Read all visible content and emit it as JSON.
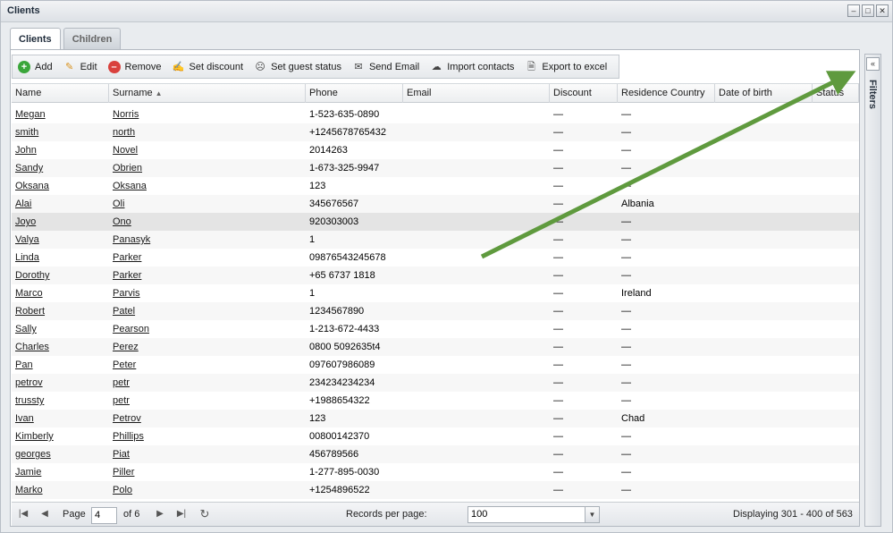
{
  "window": {
    "title": "Clients"
  },
  "tabs": [
    {
      "label": "Clients",
      "active": true
    },
    {
      "label": "Children",
      "active": false
    }
  ],
  "toolbar": {
    "add": "Add",
    "edit": "Edit",
    "remove": "Remove",
    "set_discount": "Set discount",
    "set_guest_status": "Set guest status",
    "send_email": "Send Email",
    "import_contacts": "Import contacts",
    "export_excel": "Export to excel"
  },
  "columns": {
    "name": "Name",
    "surname": "Surname",
    "phone": "Phone",
    "email": "Email",
    "discount": "Discount",
    "country": "Residence Country",
    "dob": "Date of birth",
    "status": "Status"
  },
  "rows": [
    {
      "name": "Megan",
      "surname": "Norris",
      "phone": "1-523-635-0890",
      "email": "",
      "discount": "—",
      "country": "—",
      "dob": "",
      "status": ""
    },
    {
      "name": "smith",
      "surname": "north",
      "phone": "+1245678765432",
      "email": "",
      "discount": "—",
      "country": "—",
      "dob": "",
      "status": ""
    },
    {
      "name": "John",
      "surname": "Novel",
      "phone": "2014263",
      "email": "",
      "discount": "—",
      "country": "—",
      "dob": "",
      "status": ""
    },
    {
      "name": "Sandy",
      "surname": "Obrien",
      "phone": "1-673-325-9947",
      "email": "",
      "discount": "—",
      "country": "—",
      "dob": "",
      "status": ""
    },
    {
      "name": "Oksana",
      "surname": "Oksana",
      "phone": "123",
      "email": "",
      "discount": "—",
      "country": "—",
      "dob": "",
      "status": ""
    },
    {
      "name": "Alai",
      "surname": "Oli",
      "phone": "345676567",
      "email": "",
      "discount": "—",
      "country": "Albania",
      "dob": "",
      "status": ""
    },
    {
      "name": "Joyo",
      "surname": "Ono",
      "phone": "920303003",
      "email": "",
      "discount": "—",
      "country": "—",
      "dob": "",
      "status": "",
      "selected": true
    },
    {
      "name": "Valya",
      "surname": "Panasyk",
      "phone": "1",
      "email": "",
      "discount": "—",
      "country": "—",
      "dob": "",
      "status": ""
    },
    {
      "name": "Linda",
      "surname": "Parker",
      "phone": "09876543245678",
      "email": "",
      "discount": "—",
      "country": "—",
      "dob": "",
      "status": ""
    },
    {
      "name": "Dorothy",
      "surname": "Parker",
      "phone": "+65 6737 1818",
      "email": "",
      "discount": "—",
      "country": "—",
      "dob": "",
      "status": ""
    },
    {
      "name": "Marco",
      "surname": "Parvis",
      "phone": "1",
      "email": "",
      "discount": "—",
      "country": "Ireland",
      "dob": "",
      "status": ""
    },
    {
      "name": "Robert",
      "surname": "Patel",
      "phone": "1234567890",
      "email": "",
      "discount": "—",
      "country": "—",
      "dob": "",
      "status": ""
    },
    {
      "name": "Sally",
      "surname": "Pearson",
      "phone": "1-213-672-4433",
      "email": "",
      "discount": "—",
      "country": "—",
      "dob": "",
      "status": ""
    },
    {
      "name": "Charles",
      "surname": "Perez",
      "phone": "0800 5092635t4",
      "email": "",
      "discount": "—",
      "country": "—",
      "dob": "",
      "status": ""
    },
    {
      "name": "Pan",
      "surname": "Peter",
      "phone": "097607986089",
      "email": "",
      "discount": "—",
      "country": "—",
      "dob": "",
      "status": ""
    },
    {
      "name": "petrov",
      "surname": "petr",
      "phone": "234234234234",
      "email": "",
      "discount": "—",
      "country": "—",
      "dob": "",
      "status": ""
    },
    {
      "name": "trussty",
      "surname": "petr",
      "phone": "+1988654322",
      "email": "",
      "discount": "—",
      "country": "—",
      "dob": "",
      "status": ""
    },
    {
      "name": "Ivan",
      "surname": "Petrov",
      "phone": "123",
      "email": "",
      "discount": "—",
      "country": "Chad",
      "dob": "",
      "status": ""
    },
    {
      "name": "Kimberly",
      "surname": "Phillips",
      "phone": "00800142370",
      "email": "",
      "discount": "—",
      "country": "—",
      "dob": "",
      "status": ""
    },
    {
      "name": "georges",
      "surname": "Piat",
      "phone": "456789566",
      "email": "",
      "discount": "—",
      "country": "—",
      "dob": "",
      "status": ""
    },
    {
      "name": "Jamie",
      "surname": "Piller",
      "phone": "1-277-895-0030",
      "email": "",
      "discount": "—",
      "country": "—",
      "dob": "",
      "status": ""
    },
    {
      "name": "Marko",
      "surname": "Polo",
      "phone": "+1254896522",
      "email": "",
      "discount": "—",
      "country": "—",
      "dob": "",
      "status": ""
    }
  ],
  "pager": {
    "page_label": "Page",
    "page_value": "4",
    "of_label": "of 6",
    "records_label": "Records per page:",
    "records_value": "100",
    "display_text": "Displaying 301 - 400 of 563"
  },
  "filters": {
    "label": "Filters"
  },
  "colors": {
    "arrow": "#5f9a3e"
  }
}
